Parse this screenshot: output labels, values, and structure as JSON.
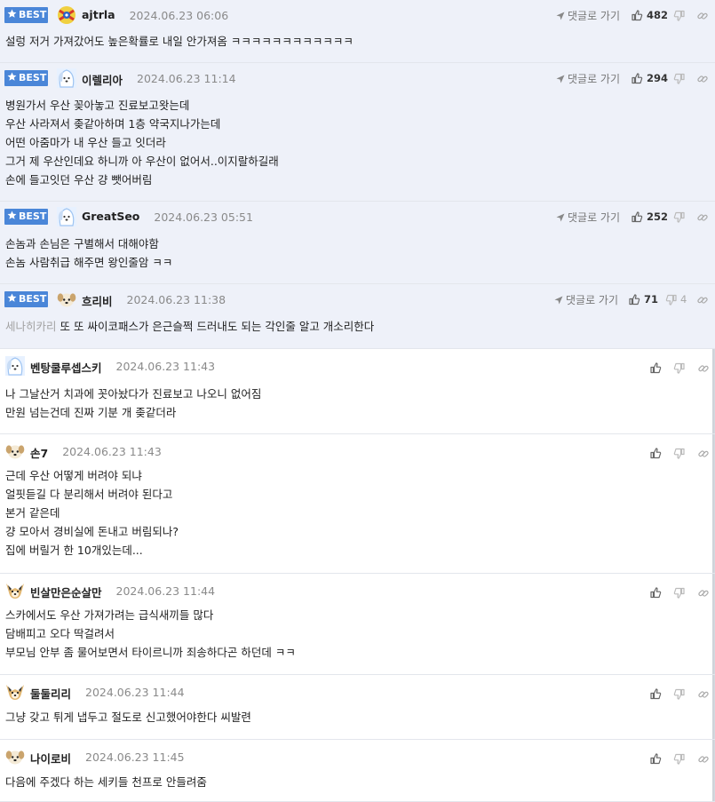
{
  "best_label": "BEST",
  "reply_label": "댓글로 가기",
  "comments": [
    {
      "nick": "ajtrla",
      "date": "2024.06.23 06:06",
      "likes": "482",
      "lines": [
        "설렁 저거 가져갔어도 높은확률로 내일 안가져옴 ㅋㅋㅋㅋㅋㅋㅋㅋㅋㅋㅋㅋ"
      ]
    },
    {
      "nick": "이렐리아",
      "date": "2024.06.23 11:14",
      "likes": "294",
      "lines": [
        "병원가서 우산 꽂아놓고 진료보고왓는데",
        "우산 사라져서 좆같아하며 1층 약국지나가는데",
        "어떤 아줌마가 내 우산 들고 잇더라",
        "그거 제 우산인데요 하니까 아 우산이 없어서..이지랄하길래",
        "손에 들고잇던 우산 걍 뺏어버림"
      ]
    },
    {
      "nick": "GreatSeo",
      "date": "2024.06.23 05:51",
      "likes": "252",
      "lines": [
        "손놈과 손님은 구별해서 대해야함",
        "손놈 사람취급 해주면 왕인줄암 ㅋㅋ"
      ]
    },
    {
      "nick": "흐리비",
      "date": "2024.06.23 11:38",
      "likes": "71",
      "dislikes": "4",
      "quote": "세나히카리",
      "lines": [
        "또 또 싸이코패스가 은근슬쩍 드러내도 되는 각인줄 알고 개소리한다"
      ]
    },
    {
      "nick": "벤탕쿨루셉스키",
      "date": "2024.06.23 11:43",
      "lines": [
        "나 그날산거 치과에 꼿아놨다가 진료보고 나오니 없어짐",
        "만원 넘는건데 진짜 기분 개 좆같더라"
      ]
    },
    {
      "nick": "손7",
      "date": "2024.06.23 11:43",
      "lines": [
        "근데 우산 어떻게 버려야 되냐",
        "얼핏듣길 다 분리해서 버려야 된다고",
        "본거 같은데",
        "걍 모아서 경비실에 돈내고 버림되나?",
        "집에 버릴거 한 10개있는데..."
      ]
    },
    {
      "nick": "빈살만은순살만",
      "date": "2024.06.23 11:44",
      "lines": [
        "스카에서도 우산 가져가려는 급식새끼들 많다",
        "담배피고 오다 딱걸려서",
        "부모님 안부 좀 물어보면서 타이르니까 죄송하다곤 하던데 ㅋㅋ"
      ]
    },
    {
      "nick": "둘둘리리",
      "date": "2024.06.23 11:44",
      "lines": [
        "그냥 갖고 튀게 냅두고 절도로 신고했어야한다 씨발련"
      ]
    },
    {
      "nick": "나이로비",
      "date": "2024.06.23 11:45",
      "lines": [
        "다음에 주겠다 하는 세키들 천프로 안들려줌"
      ]
    }
  ]
}
